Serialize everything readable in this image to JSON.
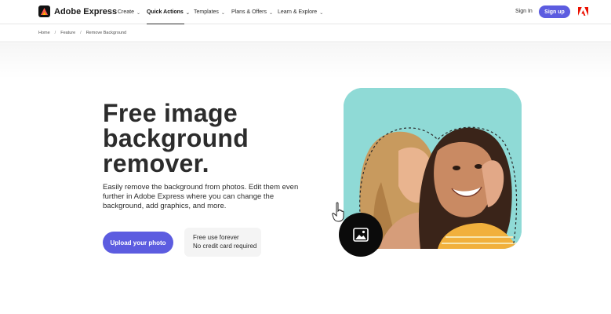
{
  "nav": {
    "brand": "Adobe Express",
    "menu": [
      {
        "label": "Create",
        "has_dropdown": true,
        "active": false
      },
      {
        "label": "Quick Actions",
        "has_dropdown": true,
        "active": true
      },
      {
        "label": "Templates",
        "has_dropdown": true,
        "active": false
      },
      {
        "label": "Plans & Offers",
        "has_dropdown": true,
        "active": false
      },
      {
        "label": "Learn & Explore",
        "has_dropdown": true,
        "active": false
      }
    ],
    "sign_in": "Sign In",
    "sign_up": "Sign up"
  },
  "breadcrumb": {
    "items": [
      "Home",
      "Feature",
      "Remove Background"
    ],
    "separator": "/"
  },
  "hero": {
    "headline_lines": [
      "Free image",
      "background",
      "remover."
    ],
    "description": "Easily remove the background from photos. Edit them even further in Adobe Express where you can change the background, add graphics, and more.",
    "upload_button": "Upload your photo",
    "free_lines": [
      "Free use forever",
      "No credit card required"
    ]
  },
  "icons": {
    "brand": "adobe-express-logo-icon",
    "adobe": "adobe-logo-icon",
    "cursor": "hand-pointer-icon",
    "image": "image-icon",
    "chevron": "chevron-down-icon"
  },
  "colors": {
    "accent": "#5c5ce0",
    "photo_bg": "#8fdad6",
    "adobe_red": "#eb1000",
    "text": "#2c2c2c"
  }
}
